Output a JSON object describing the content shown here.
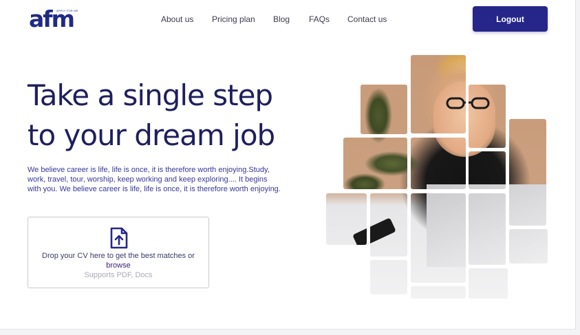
{
  "header": {
    "logo_text": "afm",
    "logo_tagline": "APPLY FOR ME",
    "nav": [
      "About us",
      "Pricing plan",
      "Blog",
      "FAQs",
      "Contact us"
    ],
    "logout_label": "Logout"
  },
  "hero": {
    "title_line1": "Take a single step",
    "title_line2": "to your dream job",
    "subtitle": "We believe career is life, life is once, it is therefore worth enjoying.Study, work, travel, tour, worship, keep working and keep exploring.... It begins with you. We believe career is life, life is once, it is therefore worth enjoying."
  },
  "upload": {
    "icon": "file-upload-icon",
    "text": "Drop your CV here to get the best matches or",
    "browse_label": "browse",
    "hint": "Supports PDF, Docs"
  },
  "colors": {
    "brand": "#26268a",
    "heading": "#1e1e5e",
    "body_text": "#36369a",
    "hint": "#a9a9b5"
  }
}
